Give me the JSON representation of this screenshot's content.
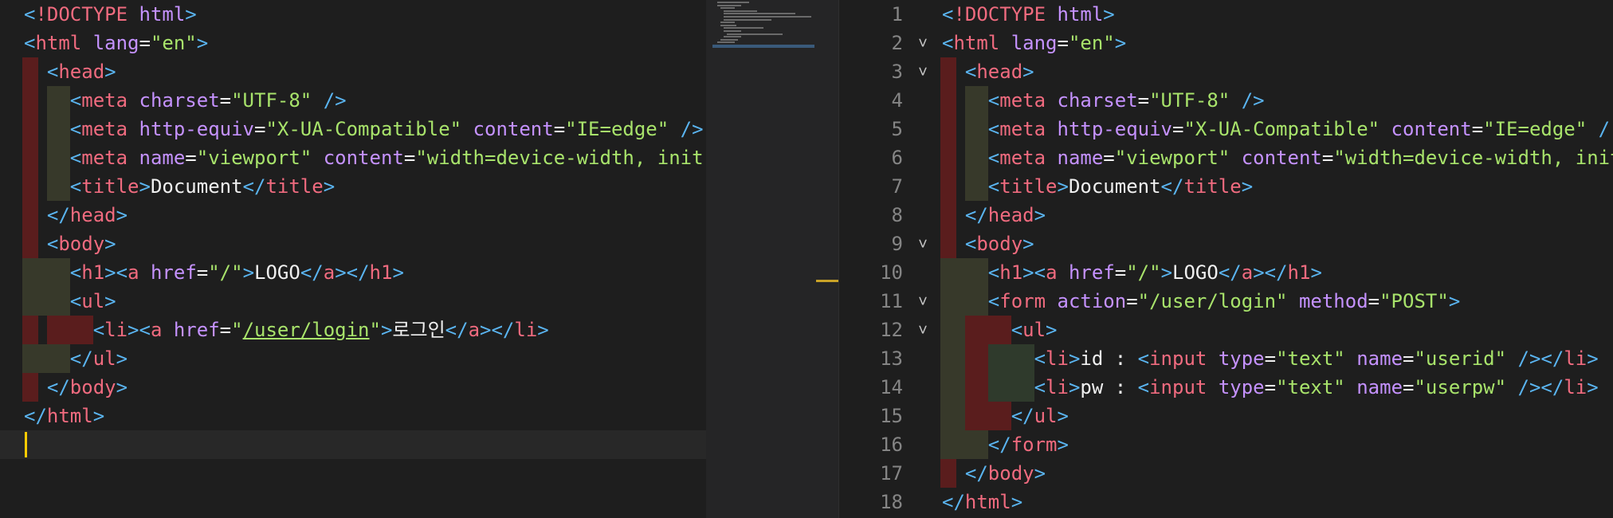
{
  "left_editor": {
    "lines": [
      [
        [
          "p",
          "<"
        ],
        [
          "tag",
          "!DOCTYPE "
        ],
        [
          "attr",
          "html"
        ],
        [
          "p",
          ">"
        ]
      ],
      [
        [
          "p",
          "<"
        ],
        [
          "tag",
          "html "
        ],
        [
          "attr",
          "lang"
        ],
        [
          "txt",
          "="
        ],
        [
          "str",
          "\"en\""
        ],
        [
          "p",
          ">"
        ]
      ],
      [
        [
          "p",
          "<"
        ],
        [
          "tag",
          "head"
        ],
        [
          "p",
          ">"
        ]
      ],
      [
        [
          "p",
          "<"
        ],
        [
          "tag",
          "meta "
        ],
        [
          "attr",
          "charset"
        ],
        [
          "txt",
          "="
        ],
        [
          "str",
          "\"UTF-8\""
        ],
        [
          "txt",
          " "
        ],
        [
          "p",
          "/>"
        ]
      ],
      [
        [
          "p",
          "<"
        ],
        [
          "tag",
          "meta "
        ],
        [
          "attr",
          "http-equiv"
        ],
        [
          "txt",
          "="
        ],
        [
          "str",
          "\"X-UA-Compatible\""
        ],
        [
          "txt",
          " "
        ],
        [
          "attr",
          "content"
        ],
        [
          "txt",
          "="
        ],
        [
          "str",
          "\"IE=edge\""
        ],
        [
          "txt",
          " "
        ],
        [
          "p",
          "/>"
        ]
      ],
      [
        [
          "p",
          "<"
        ],
        [
          "tag",
          "meta "
        ],
        [
          "attr",
          "name"
        ],
        [
          "txt",
          "="
        ],
        [
          "str",
          "\"viewport\""
        ],
        [
          "txt",
          " "
        ],
        [
          "attr",
          "content"
        ],
        [
          "txt",
          "="
        ],
        [
          "str",
          "\"width=device-width, init"
        ]
      ],
      [
        [
          "p",
          "<"
        ],
        [
          "tag",
          "title"
        ],
        [
          "p",
          ">"
        ],
        [
          "txt",
          "Document"
        ],
        [
          "p",
          "</"
        ],
        [
          "tag",
          "title"
        ],
        [
          "p",
          ">"
        ]
      ],
      [
        [
          "p",
          "</"
        ],
        [
          "tag",
          "head"
        ],
        [
          "p",
          ">"
        ]
      ],
      [
        [
          "p",
          "<"
        ],
        [
          "tag",
          "body"
        ],
        [
          "p",
          ">"
        ]
      ],
      [
        [
          "p",
          "<"
        ],
        [
          "tag",
          "h1"
        ],
        [
          "p",
          "><"
        ],
        [
          "tag",
          "a "
        ],
        [
          "attr",
          "href"
        ],
        [
          "txt",
          "="
        ],
        [
          "str",
          "\"/\""
        ],
        [
          "p",
          ">"
        ],
        [
          "txt",
          "LOGO"
        ],
        [
          "p",
          "</"
        ],
        [
          "tag",
          "a"
        ],
        [
          "p",
          "></"
        ],
        [
          "tag",
          "h1"
        ],
        [
          "p",
          ">"
        ]
      ],
      [
        [
          "p",
          "<"
        ],
        [
          "tag",
          "ul"
        ],
        [
          "p",
          ">"
        ]
      ],
      [
        [
          "p",
          "<"
        ],
        [
          "tag",
          "li"
        ],
        [
          "p",
          "><"
        ],
        [
          "tag",
          "a "
        ],
        [
          "attr",
          "href"
        ],
        [
          "txt",
          "="
        ],
        [
          "str",
          "\""
        ],
        [
          "stru",
          "/user/login"
        ],
        [
          "str",
          "\""
        ],
        [
          "p",
          ">"
        ],
        [
          "txt",
          "로그인"
        ],
        [
          "p",
          "</"
        ],
        [
          "tag",
          "a"
        ],
        [
          "p",
          "></"
        ],
        [
          "tag",
          "li"
        ],
        [
          "p",
          ">"
        ]
      ],
      [
        [
          "p",
          "</"
        ],
        [
          "tag",
          "ul"
        ],
        [
          "p",
          ">"
        ]
      ],
      [
        [
          "p",
          "</"
        ],
        [
          "tag",
          "body"
        ],
        [
          "p",
          ">"
        ]
      ],
      [
        [
          "p",
          "</"
        ],
        [
          "tag",
          "html"
        ],
        [
          "p",
          ">"
        ]
      ],
      []
    ]
  },
  "right_editor": {
    "line_numbers": [
      "1",
      "2",
      "3",
      "4",
      "5",
      "6",
      "7",
      "8",
      "9",
      "10",
      "11",
      "12",
      "13",
      "14",
      "15",
      "16",
      "17",
      "18"
    ],
    "fold_icons": [
      "",
      "˅",
      "˅",
      "",
      "",
      "",
      "",
      "",
      "˅",
      "",
      "˅",
      "˅",
      "",
      "",
      "",
      "",
      "",
      ""
    ],
    "lines": [
      [
        [
          "p",
          "<"
        ],
        [
          "tag",
          "!DOCTYPE "
        ],
        [
          "attr",
          "html"
        ],
        [
          "p",
          ">"
        ]
      ],
      [
        [
          "p",
          "<"
        ],
        [
          "tag",
          "html "
        ],
        [
          "attr",
          "lang"
        ],
        [
          "txt",
          "="
        ],
        [
          "str",
          "\"en\""
        ],
        [
          "p",
          ">"
        ]
      ],
      [
        [
          "p",
          "<"
        ],
        [
          "tag",
          "head"
        ],
        [
          "p",
          ">"
        ]
      ],
      [
        [
          "p",
          "<"
        ],
        [
          "tag",
          "meta "
        ],
        [
          "attr",
          "charset"
        ],
        [
          "txt",
          "="
        ],
        [
          "str",
          "\"UTF-8\""
        ],
        [
          "txt",
          " "
        ],
        [
          "p",
          "/>"
        ]
      ],
      [
        [
          "p",
          "<"
        ],
        [
          "tag",
          "meta "
        ],
        [
          "attr",
          "http-equiv"
        ],
        [
          "txt",
          "="
        ],
        [
          "str",
          "\"X-UA-Compatible\""
        ],
        [
          "txt",
          " "
        ],
        [
          "attr",
          "content"
        ],
        [
          "txt",
          "="
        ],
        [
          "str",
          "\"IE=edge\""
        ],
        [
          "txt",
          " "
        ],
        [
          "p",
          "/"
        ]
      ],
      [
        [
          "p",
          "<"
        ],
        [
          "tag",
          "meta "
        ],
        [
          "attr",
          "name"
        ],
        [
          "txt",
          "="
        ],
        [
          "str",
          "\"viewport\""
        ],
        [
          "txt",
          " "
        ],
        [
          "attr",
          "content"
        ],
        [
          "txt",
          "="
        ],
        [
          "str",
          "\"width=device-width, init"
        ]
      ],
      [
        [
          "p",
          "<"
        ],
        [
          "tag",
          "title"
        ],
        [
          "p",
          ">"
        ],
        [
          "txt",
          "Document"
        ],
        [
          "p",
          "</"
        ],
        [
          "tag",
          "title"
        ],
        [
          "p",
          ">"
        ]
      ],
      [
        [
          "p",
          "</"
        ],
        [
          "tag",
          "head"
        ],
        [
          "p",
          ">"
        ]
      ],
      [
        [
          "p",
          "<"
        ],
        [
          "tag",
          "body"
        ],
        [
          "p",
          ">"
        ]
      ],
      [
        [
          "p",
          "<"
        ],
        [
          "tag",
          "h1"
        ],
        [
          "p",
          "><"
        ],
        [
          "tag",
          "a "
        ],
        [
          "attr",
          "href"
        ],
        [
          "txt",
          "="
        ],
        [
          "str",
          "\"/\""
        ],
        [
          "p",
          ">"
        ],
        [
          "txt",
          "LOGO"
        ],
        [
          "p",
          "</"
        ],
        [
          "tag",
          "a"
        ],
        [
          "p",
          "></"
        ],
        [
          "tag",
          "h1"
        ],
        [
          "p",
          ">"
        ]
      ],
      [
        [
          "p",
          "<"
        ],
        [
          "tag",
          "form "
        ],
        [
          "attr",
          "action"
        ],
        [
          "txt",
          "="
        ],
        [
          "str",
          "\"/user/login\""
        ],
        [
          "txt",
          " "
        ],
        [
          "attr",
          "method"
        ],
        [
          "txt",
          "="
        ],
        [
          "str",
          "\"POST\""
        ],
        [
          "p",
          ">"
        ]
      ],
      [
        [
          "p",
          "<"
        ],
        [
          "tag",
          "ul"
        ],
        [
          "p",
          ">"
        ]
      ],
      [
        [
          "p",
          "<"
        ],
        [
          "tag",
          "li"
        ],
        [
          "p",
          ">"
        ],
        [
          "txt",
          "id : "
        ],
        [
          "p",
          "<"
        ],
        [
          "tag",
          "input "
        ],
        [
          "attr",
          "type"
        ],
        [
          "txt",
          "="
        ],
        [
          "str",
          "\"text\""
        ],
        [
          "txt",
          " "
        ],
        [
          "attr",
          "name"
        ],
        [
          "txt",
          "="
        ],
        [
          "str",
          "\"userid\""
        ],
        [
          "txt",
          " "
        ],
        [
          "p",
          "/></"
        ],
        [
          "tag",
          "li"
        ],
        [
          "p",
          ">"
        ]
      ],
      [
        [
          "p",
          "<"
        ],
        [
          "tag",
          "li"
        ],
        [
          "p",
          ">"
        ],
        [
          "txt",
          "pw : "
        ],
        [
          "p",
          "<"
        ],
        [
          "tag",
          "input "
        ],
        [
          "attr",
          "type"
        ],
        [
          "txt",
          "="
        ],
        [
          "str",
          "\"text\""
        ],
        [
          "txt",
          " "
        ],
        [
          "attr",
          "name"
        ],
        [
          "txt",
          "="
        ],
        [
          "str",
          "\"userpw\""
        ],
        [
          "txt",
          " "
        ],
        [
          "p",
          "/></"
        ],
        [
          "tag",
          "li"
        ],
        [
          "p",
          ">"
        ]
      ],
      [
        [
          "p",
          "</"
        ],
        [
          "tag",
          "ul"
        ],
        [
          "p",
          ">"
        ]
      ],
      [
        [
          "p",
          "</"
        ],
        [
          "tag",
          "form"
        ],
        [
          "p",
          ">"
        ]
      ],
      [
        [
          "p",
          "</"
        ],
        [
          "tag",
          "body"
        ],
        [
          "p",
          ">"
        ]
      ],
      [
        [
          "p",
          "</"
        ],
        [
          "tag",
          "html"
        ],
        [
          "p",
          ">"
        ]
      ]
    ]
  },
  "colors": {
    "punctuation": "#5ab4f0",
    "tag": "#f06b7f",
    "attribute": "#c592ff",
    "string": "#a8e36b",
    "text": "#f0f0f0",
    "cursor": "#ffcc00"
  }
}
